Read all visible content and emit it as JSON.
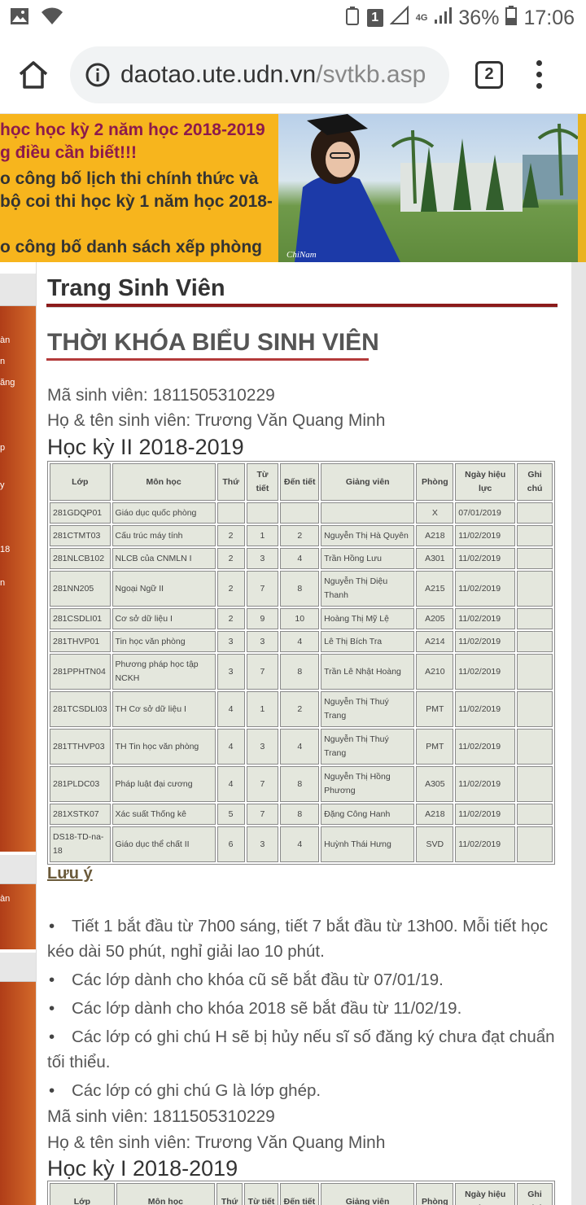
{
  "status_bar": {
    "network": "4G",
    "battery": "36%",
    "time": "17:06",
    "notification_count": "1"
  },
  "browser": {
    "url_host": "daotao.ute.udn.vn",
    "url_path": "/svtkb.asp",
    "tab_count": "2"
  },
  "banner": {
    "news": [
      "học học kỳ 2 năm học 2018-2019",
      "g điều cần biết!!!",
      "o công bố lịch thi chính thức và",
      "bộ coi thi học kỳ 1 năm học 2018-",
      "o công bố danh sách xếp phòng"
    ],
    "photo_signature": "ChiNam"
  },
  "sidebar": {
    "fragments": [
      "àn",
      "n",
      "ăng",
      "p",
      "y",
      "18",
      "n",
      "àn"
    ]
  },
  "page": {
    "title": "Trang Sinh Viên",
    "section_title": "THỜI KHÓA BIỂU SINH VIÊN",
    "student_id_line": "Mã sinh viên: 1811505310229",
    "student_name_line": "Họ & tên sinh viên: Trương Văn Quang  Minh",
    "semester_2": "Học kỳ II 2018-2019",
    "semester_1": "Học kỳ I 2018-2019"
  },
  "table": {
    "headers": [
      "Lớp",
      "Môn học",
      "Thứ",
      "Từ tiết",
      "Đến tiết",
      "Giảng viên",
      "Phòng",
      "Ngày hiệu lực",
      "Ghi chú"
    ],
    "rows": [
      [
        "281GDQP01",
        "Giáo dục quốc phòng",
        "",
        "",
        "",
        "",
        "X",
        "07/01/2019",
        ""
      ],
      [
        "281CTMT03",
        "Cấu trúc máy tính",
        "2",
        "1",
        "2",
        "Nguyễn Thị Hà Quyên",
        "A218",
        "11/02/2019",
        ""
      ],
      [
        "281NLCB102",
        "NLCB của CNMLN I",
        "2",
        "3",
        "4",
        "Trần Hồng Lưu",
        "A301",
        "11/02/2019",
        ""
      ],
      [
        "281NN205",
        "Ngoại Ngữ II",
        "2",
        "7",
        "8",
        "Nguyễn Thị Diệu Thanh",
        "A215",
        "11/02/2019",
        ""
      ],
      [
        "281CSDLI01",
        "Cơ sở dữ liệu I",
        "2",
        "9",
        "10",
        "Hoàng Thị Mỹ Lệ",
        "A205",
        "11/02/2019",
        ""
      ],
      [
        "281THVP01",
        "Tin học văn phòng",
        "3",
        "3",
        "4",
        "Lê Thị Bích Tra",
        "A214",
        "11/02/2019",
        ""
      ],
      [
        "281PPHTN04",
        "Phương pháp học tập NCKH",
        "3",
        "7",
        "8",
        "Trần Lê Nhật Hoàng",
        "A210",
        "11/02/2019",
        ""
      ],
      [
        "281TCSDLI03",
        "TH Cơ sở dữ liệu I",
        "4",
        "1",
        "2",
        "Nguyễn Thị Thuý Trang",
        "PMT",
        "11/02/2019",
        ""
      ],
      [
        "281TTHVP03",
        "TH Tin học văn phòng",
        "4",
        "3",
        "4",
        "Nguyễn Thị Thuý Trang",
        "PMT",
        "11/02/2019",
        ""
      ],
      [
        "281PLDC03",
        "Pháp luật đại cương",
        "4",
        "7",
        "8",
        "Nguyễn Thị Hồng Phương",
        "A305",
        "11/02/2019",
        ""
      ],
      [
        "281XSTK07",
        "Xác suất Thống kê",
        "5",
        "7",
        "8",
        "Đặng Công Hanh",
        "A218",
        "11/02/2019",
        ""
      ],
      [
        "DS18-TD-na-18",
        "Giáo dục thể chất II",
        "6",
        "3",
        "4",
        "Huỳnh Thái Hưng",
        "SVD",
        "11/02/2019",
        ""
      ]
    ]
  },
  "notes": {
    "title": "Lưu ý",
    "items": [
      "Tiết 1 bắt đầu từ 7h00 sáng, tiết 7 bắt đầu từ 13h00. Mỗi tiết học kéo dài 50 phút, nghỉ giải lao 10 phút.",
      "Các lớp dành cho khóa cũ sẽ bắt đầu từ 07/01/19.",
      "Các lớp dành cho khóa 2018 sẽ bắt đầu từ 11/02/19.",
      "Các lớp có ghi chú H sẽ bị hủy nếu sĩ số đăng ký chưa đạt chuẩn tối thiểu.",
      "Các lớp có ghi chú G là lớp ghép."
    ]
  },
  "colors": {
    "accent_red": "#8b1a1a",
    "banner_yellow": "#f7b51d",
    "table_cell": "#e4e7dd",
    "sidebar_orange": "#c4521f"
  }
}
